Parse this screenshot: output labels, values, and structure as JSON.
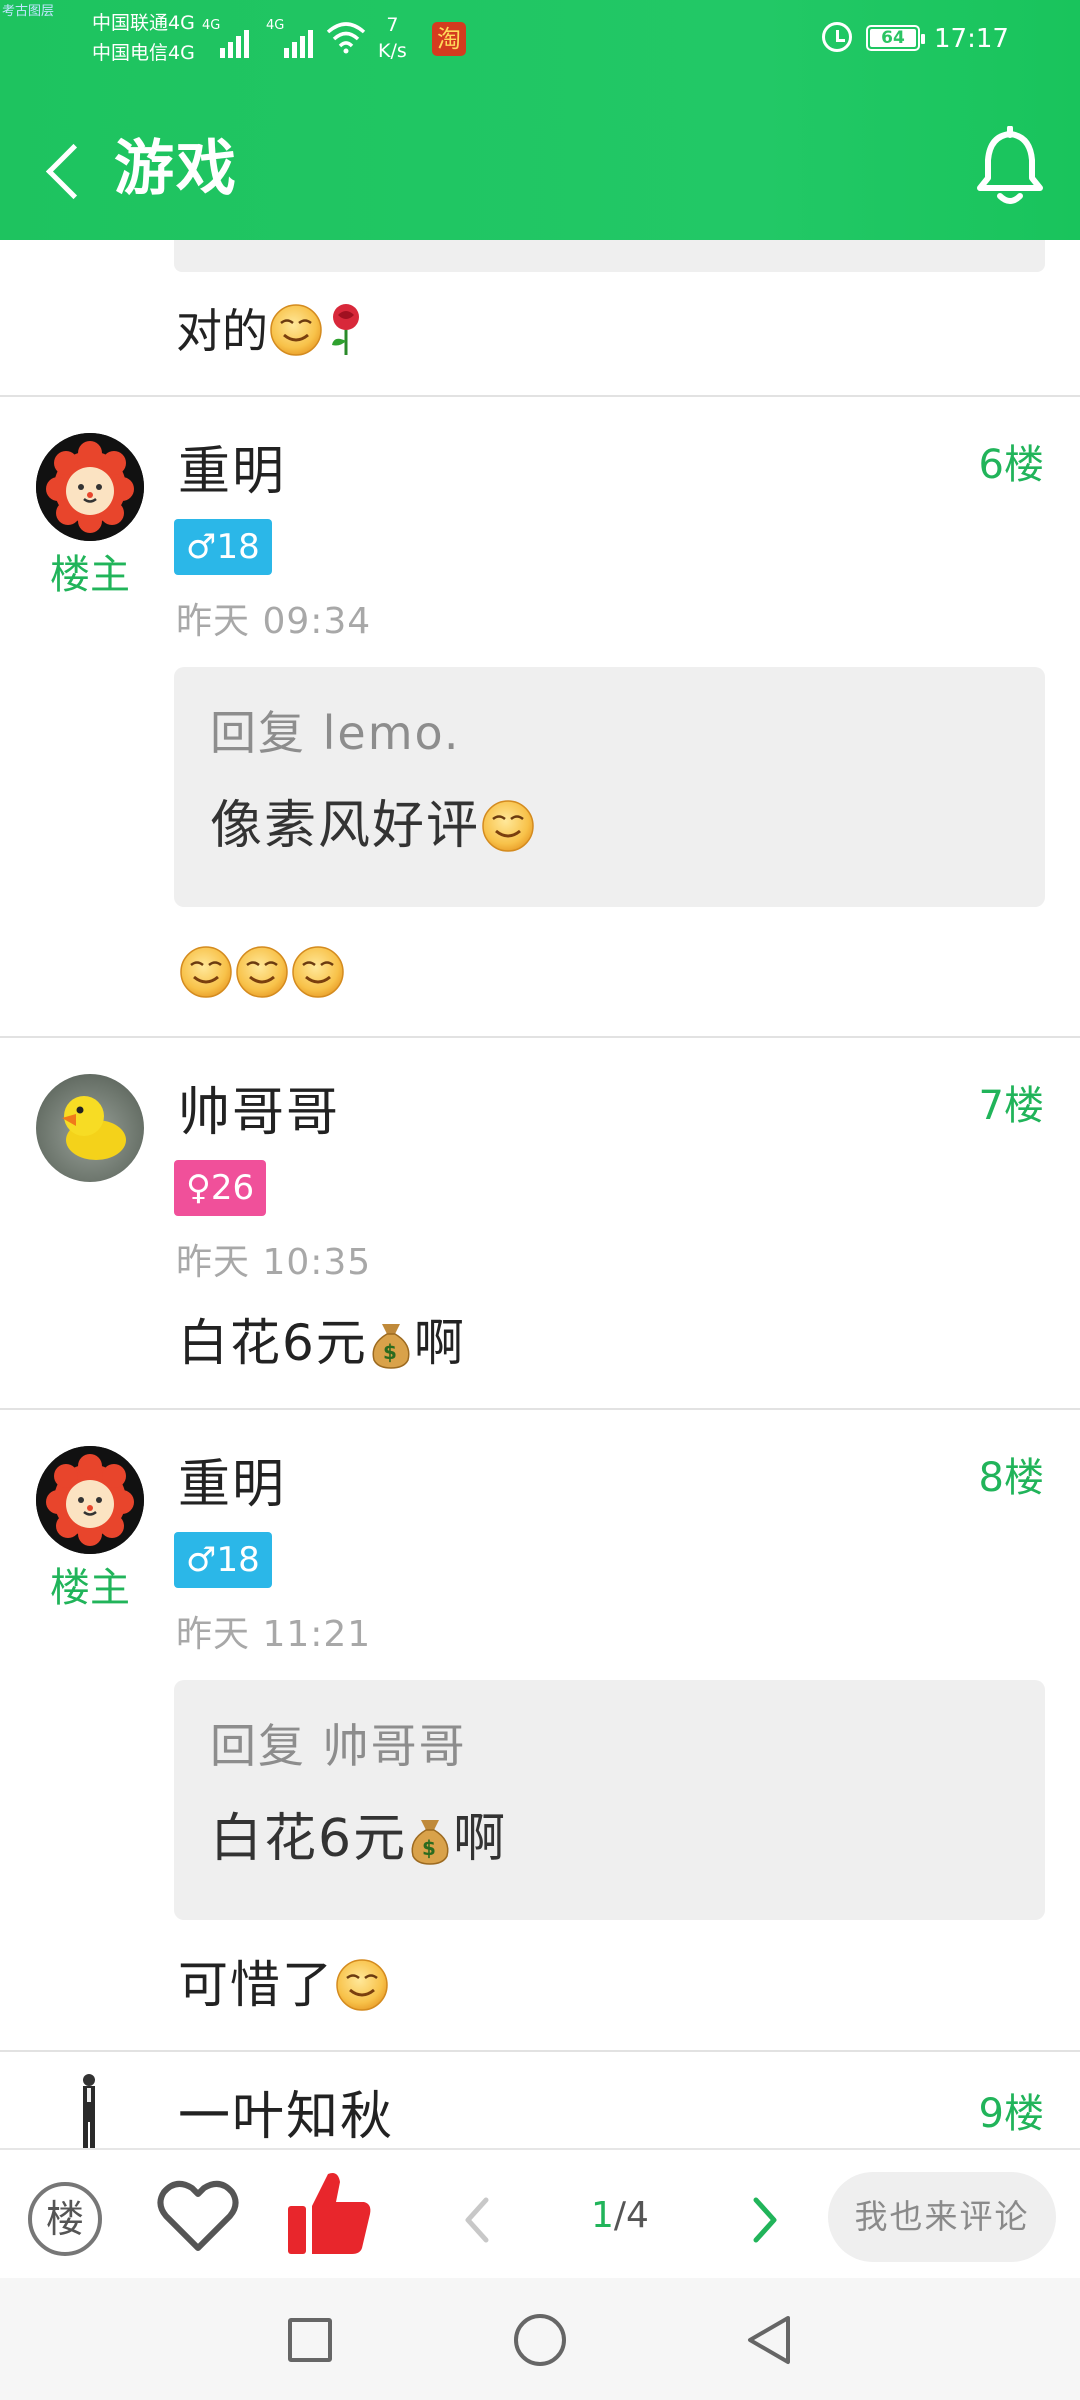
{
  "status_bar": {
    "tiny_label": "考古图层",
    "carrier_1": "中国联通4G",
    "carrier_2": "中国电信4G",
    "signal_1_label": "4G",
    "signal_2_label": "4G",
    "net_speed_value": "7",
    "net_speed_unit": "K/s",
    "taobao_icon_text": "淘",
    "battery_level": "64",
    "time": "17:17"
  },
  "header": {
    "title": "游戏"
  },
  "comments": [
    {
      "text": "对的"
    },
    {
      "username": "重明",
      "owner_tag": "楼主",
      "floor": "6楼",
      "gender_badge": "♂18",
      "time": "昨天 09:34",
      "reply_label": "回复 lemo.",
      "reply_quote": "像素风好评",
      "text": ""
    },
    {
      "username": "帅哥哥",
      "floor": "7楼",
      "gender_badge": "♀26",
      "time": "昨天 10:35",
      "text_before": "白花6元",
      "text_after": "啊"
    },
    {
      "username": "重明",
      "owner_tag": "楼主",
      "floor": "8楼",
      "gender_badge": "♂18",
      "time": "昨天 11:21",
      "reply_label": "回复 帅哥哥",
      "reply_quote_before": "白花6元",
      "reply_quote_after": "啊",
      "text": "可惜了"
    },
    {
      "username": "一叶知秋",
      "floor": "9楼"
    }
  ],
  "action_bar": {
    "louzhu_label": "楼",
    "page_current": "1",
    "page_total": "/4",
    "comment_placeholder": "我也来评论"
  },
  "colors": {
    "header_green": "#1ec35f",
    "accent_green": "#21b45a",
    "male_badge": "#2bb7e8",
    "female_badge": "#f0509a",
    "like_red": "#e8262c"
  },
  "icons": [
    "back-arrow-icon",
    "bell-icon",
    "heart-icon",
    "thumbs-up-icon",
    "chevron-left-icon",
    "chevron-right-icon",
    "smile-emoji-icon",
    "rose-emoji-icon",
    "money-bag-emoji-icon"
  ]
}
